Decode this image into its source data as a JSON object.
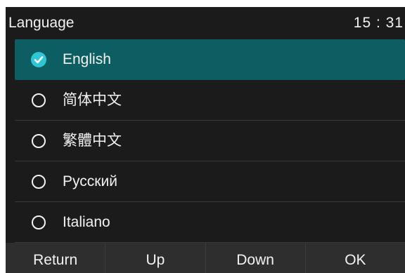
{
  "status_bar": {
    "title": "Language",
    "time": "15 : 31"
  },
  "languages": [
    {
      "label": "English",
      "selected": true
    },
    {
      "label": "简体中文",
      "selected": false
    },
    {
      "label": "繁體中文",
      "selected": false
    },
    {
      "label": "Русский",
      "selected": false
    },
    {
      "label": "Italiano",
      "selected": false
    }
  ],
  "softkeys": {
    "return_label": "Return",
    "up_label": "Up",
    "down_label": "Down",
    "ok_label": "OK"
  },
  "colors": {
    "background": "#1b1b1b",
    "selection": "#0d5e63",
    "softkey_bar": "#2e2e2e",
    "check_fill": "#2fc6d6",
    "text": "#f2f2f2"
  },
  "icons": {
    "selected": "check-circle-icon",
    "unselected": "radio-circle-icon"
  }
}
